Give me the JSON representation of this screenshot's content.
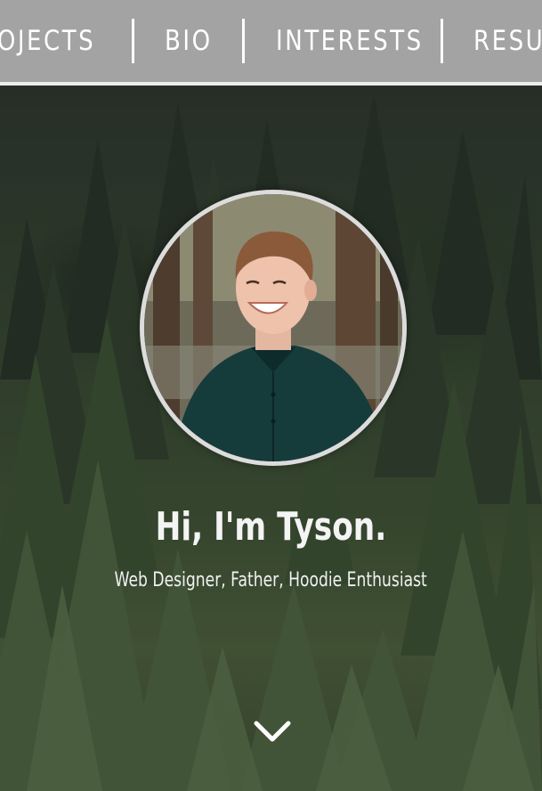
{
  "nav": {
    "items": [
      {
        "label": "PROJECTS"
      },
      {
        "label": "BIO"
      },
      {
        "label": "INTERESTS"
      },
      {
        "label": "RESUME"
      }
    ]
  },
  "hero": {
    "avatar_icon": "profile-photo",
    "headline": "Hi, I'm Tyson.",
    "tagline": "Web Designer, Father, Hoodie Enthusiast",
    "scroll_icon": "chevron-down-icon"
  },
  "colors": {
    "nav_background": "#a3a3a3",
    "nav_text": "#ffffff",
    "avatar_border": "#dcdcdc",
    "hero_text": "#f4f4f4"
  }
}
